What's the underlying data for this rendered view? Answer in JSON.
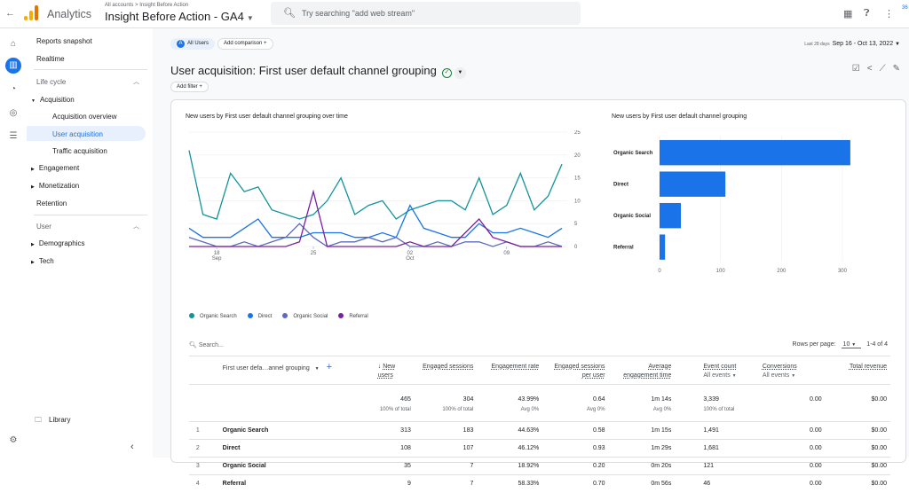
{
  "topbar": {
    "app_name": "Analytics",
    "breadcrumb": "All accounts > Insight Before Action",
    "property": "Insight Before Action - GA4",
    "search_placeholder": "Try searching \"add web stream\"",
    "account_badge": "36"
  },
  "nav": {
    "reports_snapshot": "Reports snapshot",
    "realtime": "Realtime",
    "lifecycle": "Life cycle",
    "acquisition": "Acquisition",
    "acquisition_overview": "Acquisition overview",
    "user_acquisition": "User acquisition",
    "traffic_acquisition": "Traffic acquisition",
    "engagement": "Engagement",
    "monetization": "Monetization",
    "retention": "Retention",
    "user": "User",
    "demographics": "Demographics",
    "tech": "Tech",
    "library": "Library"
  },
  "header": {
    "all_users": "All Users",
    "add_comparison": "Add comparison",
    "date_label": "Last 28 days",
    "date_range": "Sep 16 - Oct 13, 2022",
    "title": "User acquisition: First user default channel grouping",
    "add_filter": "Add filter"
  },
  "chart_data": [
    {
      "type": "line",
      "title": "New users by First user default channel grouping over time",
      "x": [
        "Sep 16",
        "Sep 17",
        "Sep 18",
        "Sep 19",
        "Sep 20",
        "Sep 21",
        "Sep 22",
        "Sep 23",
        "Sep 24",
        "Sep 25",
        "Sep 26",
        "Sep 27",
        "Sep 28",
        "Sep 29",
        "Sep 30",
        "Oct 1",
        "Oct 2",
        "Oct 3",
        "Oct 4",
        "Oct 5",
        "Oct 6",
        "Oct 7",
        "Oct 8",
        "Oct 9",
        "Oct 10",
        "Oct 11",
        "Oct 12",
        "Oct 13"
      ],
      "x_tick_labels": [
        {
          "day": "18",
          "month": "Sep",
          "index": 2
        },
        {
          "day": "25",
          "month": "",
          "index": 9
        },
        {
          "day": "02",
          "month": "Oct",
          "index": 16
        },
        {
          "day": "09",
          "month": "",
          "index": 23
        }
      ],
      "y_ticks": [
        0,
        5,
        10,
        15,
        20,
        25
      ],
      "ylim": [
        0,
        25
      ],
      "colors": [
        "#12939a",
        "#1a73e8",
        "#5c6bc0",
        "#7b1fa2"
      ],
      "series": [
        {
          "name": "Organic Search",
          "values": [
            21,
            7,
            6,
            16,
            12,
            13,
            8,
            7,
            6,
            7,
            10,
            15,
            7,
            9,
            10,
            6,
            8,
            9,
            10,
            10,
            8,
            15,
            7,
            9,
            16,
            8,
            11,
            18
          ]
        },
        {
          "name": "Direct",
          "values": [
            4,
            2,
            2,
            2,
            4,
            6,
            2,
            2,
            2,
            3,
            3,
            3,
            2,
            2,
            3,
            2,
            9,
            4,
            3,
            2,
            2,
            5,
            3,
            3,
            4,
            3,
            2,
            4
          ]
        },
        {
          "name": "Organic Social",
          "values": [
            2,
            1,
            0,
            0,
            1,
            0,
            1,
            2,
            5,
            2,
            0,
            1,
            1,
            2,
            1,
            2,
            0,
            0,
            1,
            0,
            1,
            1,
            0,
            1,
            0,
            0,
            1,
            0
          ]
        },
        {
          "name": "Referral",
          "values": [
            0,
            0,
            0,
            0,
            0,
            0,
            0,
            0,
            1,
            12,
            0,
            0,
            0,
            0,
            0,
            0,
            1,
            0,
            0,
            0,
            3,
            6,
            2,
            1,
            0,
            0,
            0,
            0
          ]
        }
      ],
      "legend": "bottom"
    },
    {
      "type": "bar",
      "title": "New users by First user default channel grouping",
      "categories": [
        "Organic Search",
        "Direct",
        "Organic Social",
        "Referral"
      ],
      "values": [
        313,
        108,
        35,
        9
      ],
      "x_ticks": [
        0,
        100,
        200,
        300
      ],
      "xlim": [
        0,
        335
      ],
      "color": "#1a73e8"
    }
  ],
  "table": {
    "search_placeholder": "Search...",
    "rows_per_page_label": "Rows per page:",
    "rows_per_page": "10",
    "range": "1-4 of 4",
    "dimension_header": "First user defa…annel grouping",
    "headers": [
      "New users",
      "Engaged sessions",
      "Engagement rate",
      "Engaged sessions per user",
      "Average engagement time",
      "Event count",
      "Conversions",
      "Total revenue"
    ],
    "event_count_sub": "All events",
    "conversions_sub": "All events",
    "totals": [
      "465",
      "304",
      "43.99%",
      "0.64",
      "1m 14s",
      "3,339",
      "0.00",
      "$0.00"
    ],
    "totals_sub": [
      "100% of total",
      "100% of total",
      "Avg 0%",
      "Avg 0%",
      "Avg 0%",
      "100% of total",
      "",
      ""
    ],
    "rows": [
      {
        "n": "1",
        "name": "Organic Search",
        "cells": [
          "313",
          "183",
          "44.63%",
          "0.58",
          "1m 15s",
          "1,491",
          "0.00",
          "$0.00"
        ]
      },
      {
        "n": "2",
        "name": "Direct",
        "cells": [
          "108",
          "107",
          "46.12%",
          "0.93",
          "1m 29s",
          "1,681",
          "0.00",
          "$0.00"
        ]
      },
      {
        "n": "3",
        "name": "Organic Social",
        "cells": [
          "35",
          "7",
          "18.92%",
          "0.20",
          "0m 20s",
          "121",
          "0.00",
          "$0.00"
        ]
      },
      {
        "n": "4",
        "name": "Referral",
        "cells": [
          "9",
          "7",
          "58.33%",
          "0.70",
          "0m 56s",
          "46",
          "0.00",
          "$0.00"
        ]
      }
    ]
  }
}
